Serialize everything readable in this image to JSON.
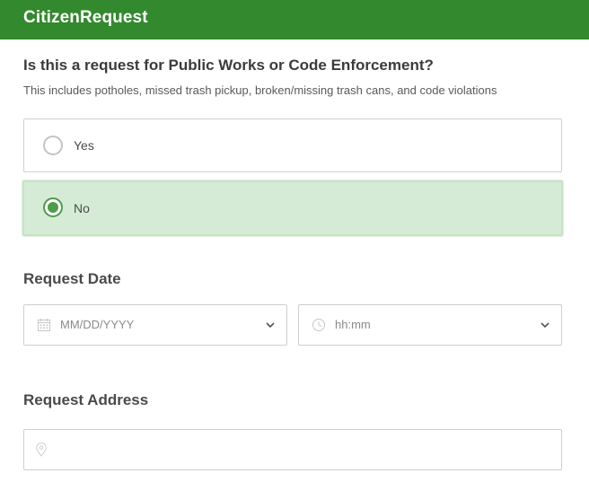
{
  "app": {
    "title": "CitizenRequest"
  },
  "question": {
    "title": "Is this a request for Public Works or Code Enforcement?",
    "description": "This includes potholes, missed trash pickup, broken/missing trash cans, and code violations",
    "options": [
      {
        "label": "Yes",
        "selected": false
      },
      {
        "label": "No",
        "selected": true
      }
    ]
  },
  "request_date": {
    "label": "Request Date",
    "date_placeholder": "MM/DD/YYYY",
    "time_placeholder": "hh:mm",
    "date_icon": "calendar-icon",
    "time_icon": "clock-icon"
  },
  "request_address": {
    "label": "Request Address",
    "value": "",
    "icon": "map-pin-icon"
  },
  "colors": {
    "header": "#33892e",
    "selected_bg": "#d6ebd6",
    "selected_radio": "#4e9b4a"
  }
}
